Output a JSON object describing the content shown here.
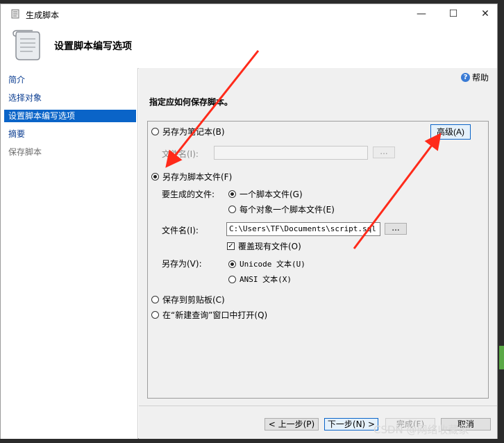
{
  "window": {
    "title": "生成脚本",
    "controls": {
      "minimize": "—",
      "maximize": "☐",
      "close": "✕"
    },
    "header_title": "设置脚本编写选项"
  },
  "sidebar": {
    "items": [
      {
        "label": "简介",
        "state": "normal"
      },
      {
        "label": "选择对象",
        "state": "normal"
      },
      {
        "label": "设置脚本编写选项",
        "state": "selected"
      },
      {
        "label": "摘要",
        "state": "normal"
      },
      {
        "label": "保存脚本",
        "state": "disabled"
      }
    ]
  },
  "main": {
    "help_label": "帮助",
    "help_icon": "?",
    "instruction": "指定应如何保存脚本。",
    "advanced_button": "高级(A)",
    "options": {
      "save_as_notebook": "另存为笔记本(B)",
      "notebook_filename_label": "文件名(I):",
      "notebook_browse": "...",
      "save_as_script_file": "另存为脚本文件(F)",
      "files_to_generate_label": "要生成的文件:",
      "single_file": "一个脚本文件(G)",
      "file_per_object": "每个对象一个脚本文件(E)",
      "filename_label": "文件名(I):",
      "filename_value": "C:\\Users\\TF\\Documents\\script.sql",
      "browse": "...",
      "overwrite_label": "覆盖现有文件(O)",
      "overwrite_mark": "✓",
      "save_as_label": "另存为(V):",
      "unicode_text": "Unicode 文本(U)",
      "ansi_text": "ANSI 文本(X)",
      "save_to_clipboard": "保存到剪贴板(C)",
      "open_in_new_query": "在“新建查询”窗口中打开(Q)"
    }
  },
  "footer": {
    "previous": "< 上一步(P)",
    "next": "下一步(N) >",
    "finish": "完成(F)",
    "cancel": "取消"
  },
  "watermark": "CSDN @网络收藏家",
  "colors": {
    "selection": "#0a64c8",
    "annotation_arrow": "#ff2a1a",
    "content_bg": "#f0f0f0"
  },
  "icons": [
    "app-script-icon",
    "scroll-icon",
    "help-icon",
    "checkmark-icon"
  ]
}
